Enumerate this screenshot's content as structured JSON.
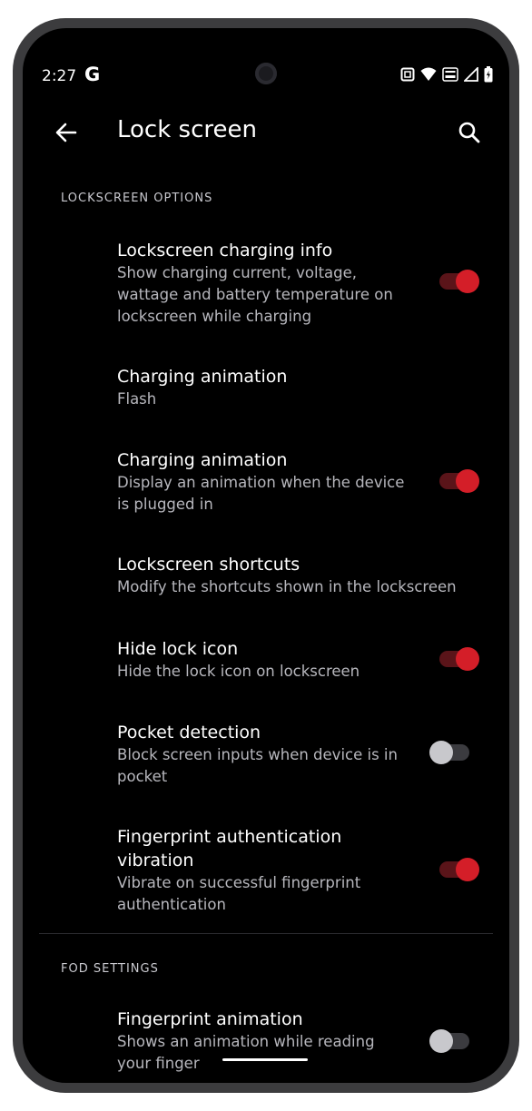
{
  "status_bar": {
    "time": "2:27",
    "google_icon": "G"
  },
  "app_bar": {
    "title": "Lock screen",
    "back_icon": "arrow-left-icon",
    "search_icon": "search-icon"
  },
  "sections": [
    {
      "header": "LOCKSCREEN OPTIONS",
      "items": [
        {
          "title": "Lockscreen charging info",
          "summary": "Show charging current, voltage, wattage and battery temperature on lockscreen while charging",
          "toggle": true
        },
        {
          "title": "Charging animation",
          "summary": "Flash"
        },
        {
          "title": "Charging animation",
          "summary": "Display an animation when the device is plugged in",
          "toggle": true
        },
        {
          "title": "Lockscreen shortcuts",
          "summary": "Modify the shortcuts shown in the lockscreen"
        },
        {
          "title": "Hide lock icon",
          "summary": "Hide the lock icon on lockscreen",
          "toggle": true
        },
        {
          "title": "Pocket detection",
          "summary": "Block screen inputs when device is in pocket",
          "toggle": false
        },
        {
          "title": "Fingerprint authentication vibration",
          "summary": "Vibrate on successful fingerprint authentication",
          "toggle": true
        }
      ]
    },
    {
      "header": "FOD SETTINGS",
      "items": [
        {
          "title": "Fingerprint animation",
          "summary": "Shows an animation while reading your finger",
          "toggle": false
        }
      ]
    }
  ],
  "colors": {
    "accent": "#d41e28",
    "background": "#000000",
    "frame": "#3c3c3e"
  }
}
